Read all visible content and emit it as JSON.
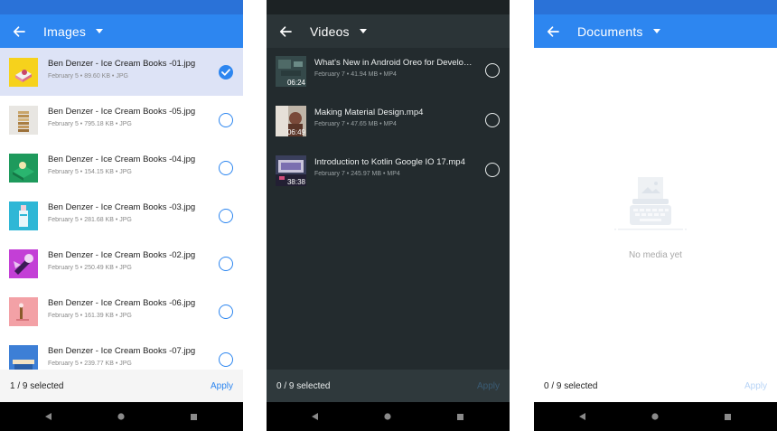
{
  "colors": {
    "primary": "#2d86f0",
    "primary_dark": "#2a72d8",
    "selected_row": "#dde3f6",
    "dark_bg": "#232b2e",
    "dark_appbar": "#2b3437",
    "dark_statusbar": "#1c2224",
    "dark_bottombar": "#2f393c",
    "navbar": "#000000"
  },
  "screens": [
    {
      "title": "Images",
      "items": [
        {
          "name": "Ben Denzer - Ice Cream Books -01.jpg",
          "meta": "February 5 • 89.60 KB • JPG",
          "thumb": "ice-cream-book-yellow-thumbnail",
          "selected": true
        },
        {
          "name": "Ben Denzer - Ice Cream Books -05.jpg",
          "meta": "February 5 • 795.18 KB • JPG",
          "thumb": "ice-cream-book-stack-thumbnail",
          "selected": false
        },
        {
          "name": "Ben Denzer - Ice Cream Books -04.jpg",
          "meta": "February 5 • 154.15 KB • JPG",
          "thumb": "ice-cream-book-green-thumbnail",
          "selected": false
        },
        {
          "name": "Ben Denzer - Ice Cream Books -03.jpg",
          "meta": "February 5 • 281.68 KB • JPG",
          "thumb": "ice-cream-book-cyan-thumbnail",
          "selected": false
        },
        {
          "name": "Ben Denzer - Ice Cream Books -02.jpg",
          "meta": "February 5 • 250.49 KB • JPG",
          "thumb": "ice-cream-book-purple-thumbnail",
          "selected": false
        },
        {
          "name": "Ben Denzer - Ice Cream Books -06.jpg",
          "meta": "February 5 • 161.39 KB • JPG",
          "thumb": "ice-cream-book-pink-thumbnail",
          "selected": false
        },
        {
          "name": "Ben Denzer - Ice Cream Books -07.jpg",
          "meta": "February 5 • 239.77 KB • JPG",
          "thumb": "ice-cream-book-blue-thumbnail",
          "selected": false
        }
      ],
      "selected_count": "1 / 9 selected",
      "apply_label": "Apply"
    },
    {
      "title": "Videos",
      "items": [
        {
          "name": "What's New in Android Oreo for Develop...",
          "meta": "February 7 • 41.94 MB • MP4",
          "duration": "06:24",
          "thumb": "android-oreo-video-thumbnail",
          "selected": false
        },
        {
          "name": "Making Material Design.mp4",
          "meta": "February 7 • 47.65 MB • MP4",
          "duration": "06:49",
          "thumb": "material-design-video-thumbnail",
          "selected": false
        },
        {
          "name": "Introduction to Kotlin Google IO 17.mp4",
          "meta": "February 7 • 245.97 MB • MP4",
          "duration": "38:38",
          "thumb": "kotlin-io-video-thumbnail",
          "selected": false
        }
      ],
      "selected_count": "0 / 9 selected",
      "apply_label": "Apply"
    },
    {
      "title": "Documents",
      "empty_message": "No media yet",
      "selected_count": "0 / 9 selected",
      "apply_label": "Apply"
    }
  ]
}
